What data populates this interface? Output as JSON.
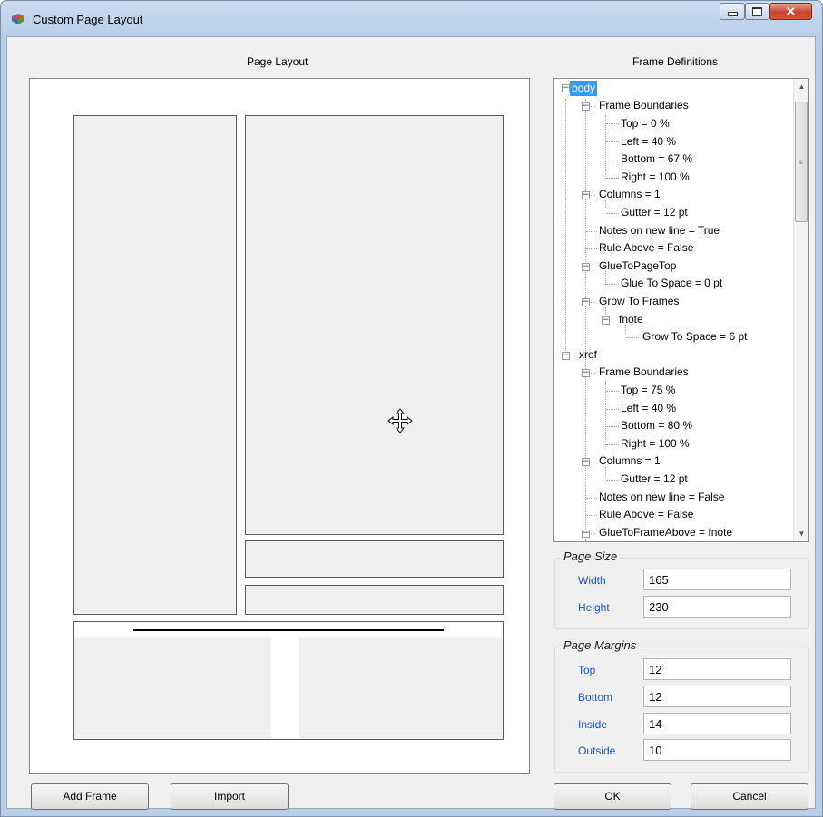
{
  "window": {
    "title": "Custom Page Layout"
  },
  "labels": {
    "page_layout": "Page Layout",
    "frame_definitions": "Frame Definitions"
  },
  "tree": [
    {
      "text": "body",
      "selected": true
    },
    {
      "text": "Frame Boundaries"
    },
    {
      "text": "Top = 0 %"
    },
    {
      "text": "Left = 40 %"
    },
    {
      "text": "Bottom = 67 %"
    },
    {
      "text": "Right = 100 %"
    },
    {
      "text": "Columns = 1"
    },
    {
      "text": "Gutter = 12 pt"
    },
    {
      "text": "Notes on new line = True"
    },
    {
      "text": "Rule Above = False"
    },
    {
      "text": "GlueToPageTop"
    },
    {
      "text": "Glue To Space = 0 pt"
    },
    {
      "text": "Grow To Frames"
    },
    {
      "text": "fnote"
    },
    {
      "text": "Grow To Space = 6 pt"
    },
    {
      "text": "xref"
    },
    {
      "text": "Frame Boundaries"
    },
    {
      "text": "Top = 75 %"
    },
    {
      "text": "Left = 40 %"
    },
    {
      "text": "Bottom = 80 %"
    },
    {
      "text": "Right = 100 %"
    },
    {
      "text": "Columns = 1"
    },
    {
      "text": "Gutter = 12 pt"
    },
    {
      "text": "Notes on new line = False"
    },
    {
      "text": "Rule Above = False"
    },
    {
      "text": "GlueToFrameAbove = fnote"
    }
  ],
  "page_size": {
    "title": "Page Size",
    "width_label": "Width",
    "width": "165",
    "height_label": "Height",
    "height": "230"
  },
  "page_margins": {
    "title": "Page Margins",
    "top_label": "Top",
    "top": "12",
    "bottom_label": "Bottom",
    "bottom": "12",
    "inside_label": "Inside",
    "inside": "14",
    "outside_label": "Outside",
    "outside": "10"
  },
  "buttons": {
    "add_frame": "Add Frame",
    "import": "Import",
    "ok": "OK",
    "cancel": "Cancel"
  },
  "colors": {
    "selection": "#3399ff",
    "field_label": "#1c55c4"
  }
}
